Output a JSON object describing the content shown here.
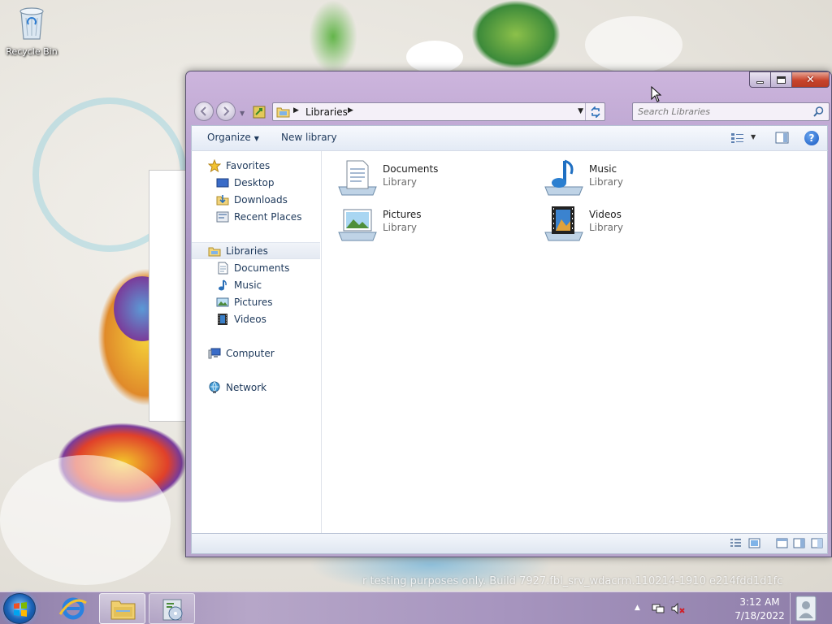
{
  "desktop": {
    "recycle_bin_label": "Recycle Bin",
    "watermark": "r testing purposes only. Build 7927.fbl_srv_wdacrm.110214-1910  e214fdd1d1fc"
  },
  "window": {
    "address": {
      "crumb": "Libraries"
    },
    "search": {
      "placeholder": "Search Libraries"
    },
    "toolbar": {
      "organize_label": "Organize",
      "new_library_label": "New library"
    },
    "nav": {
      "favorites": {
        "label": "Favorites",
        "items": [
          "Desktop",
          "Downloads",
          "Recent Places"
        ]
      },
      "libraries": {
        "label": "Libraries",
        "items": [
          "Documents",
          "Music",
          "Pictures",
          "Videos"
        ]
      },
      "computer": "Computer",
      "network": "Network"
    },
    "libraries": [
      {
        "name": "Documents",
        "kind": "Library",
        "icon": "documents-library-icon"
      },
      {
        "name": "Music",
        "kind": "Library",
        "icon": "music-library-icon"
      },
      {
        "name": "Pictures",
        "kind": "Library",
        "icon": "pictures-library-icon"
      },
      {
        "name": "Videos",
        "kind": "Library",
        "icon": "videos-library-icon"
      }
    ]
  },
  "taskbar": {
    "apps": [
      "internet-explorer-icon",
      "windows-explorer-icon",
      "media-center-icon"
    ],
    "clock": {
      "time": "3:12 AM",
      "date": "7/18/2022"
    }
  },
  "colors": {
    "accent": "#1e395b",
    "window_frame": "#b9a3cf",
    "close_button": "#c8432b",
    "taskbar": "#a795bf"
  }
}
